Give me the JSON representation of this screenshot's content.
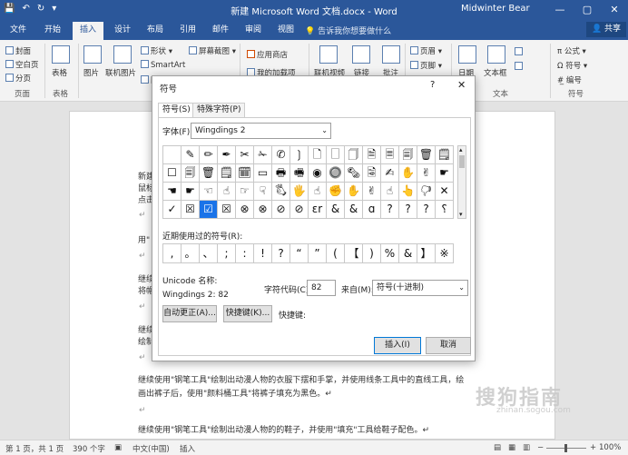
{
  "window": {
    "title": "新建 Microsoft Word 文档.docx  -  Word",
    "user": "Midwinter Bear",
    "min_icon": "—",
    "max_icon": "▢",
    "close_icon": "✕",
    "quick_access": [
      "💾",
      "↶",
      "↻",
      "▾"
    ]
  },
  "tabs": [
    "文件",
    "开始",
    "插入",
    "设计",
    "布局",
    "引用",
    "邮件",
    "审阅",
    "视图"
  ],
  "active_tab": "插入",
  "tell_me": "告诉我你想要做什么",
  "sign_in_icon": "",
  "share_label": "共享",
  "ribbon": {
    "pages": {
      "cover": "封面",
      "blank": "空白页",
      "break": "分页",
      "group": "页面"
    },
    "table": {
      "label": "表格",
      "group": "表格"
    },
    "illustrations": {
      "picture": "图片",
      "online_picture": "联机图片",
      "shapes": "形状",
      "smartart": "SmartArt",
      "chart": "图表",
      "screenshot": "屏幕截图"
    },
    "addins": {
      "store": "应用商店",
      "my_addins": "我的加载项"
    },
    "media": {
      "online_video": "联机视频"
    },
    "links": {
      "link": "链接"
    },
    "comments": {
      "comment": "批注"
    },
    "header_footer": {
      "header": "页眉",
      "footer": "页脚",
      "page_number": "页码"
    },
    "text": {
      "date": "日期",
      "textbox": "文本框",
      "group": "文本"
    },
    "symbols": {
      "equation": "公式",
      "symbol": "符号",
      "numbering": "编号",
      "group": "符号"
    }
  },
  "document": {
    "lines": [
      "新建",
      "鼠标",
      "点击",
      "↵",
      "用\"",
      "↵",
      "继续",
      "将帽",
      "↵",
      "继续",
      "绘制",
      "↵"
    ],
    "para1a": "继续使用\"钢笔工具\"绘制出动漫人物的衣服下摆和手掌，并使用线条工具中的直线工具，绘",
    "para1b": "画出裤子后，使用\"颜料桶工具\"将裤子填充为黑色。↵",
    "para_mark": "↵",
    "para2": "继续使用\"钢笔工具\"绘制出动漫人物的的鞋子，并使用\"填充\"工具给鞋子配色。↵"
  },
  "dialog": {
    "title": "符号",
    "help": "?",
    "close": "✕",
    "tabs": [
      "符号(S)",
      "特殊字符(P)"
    ],
    "font_label": "字体(F):",
    "font_value": "Wingdings 2",
    "symbols": [
      "",
      "✎",
      "✏",
      "✒",
      "✂",
      "✁",
      "✆",
      "❳",
      "🗋",
      "🗌",
      "🗍",
      "🗎",
      "🗏",
      "🗐",
      "🗑",
      "🗒",
      "☐",
      "🗐",
      "🗑",
      "🗒",
      "🗓",
      "▭",
      "🖶",
      "🖷",
      "◉",
      "🔘",
      "🗞",
      "🗟",
      "✍",
      "✋",
      "✌",
      "☛",
      "☚",
      "☛",
      "☜",
      "☝",
      "☞",
      "☟",
      "🖏",
      "🖐",
      "☝",
      "✊",
      "✋",
      "✌",
      "☝",
      "👆",
      "🖓",
      "✕",
      "✓",
      "☒",
      "☑",
      "☒",
      "⊗",
      "⊗",
      "⊘",
      "⊘",
      "ɛr",
      "&",
      "&",
      "ɑ",
      "?",
      "?",
      "?",
      "⸮"
    ],
    "selected_index": 50,
    "recent_label": "近期使用过的符号(R):",
    "recent": [
      ",",
      "。",
      "、",
      ";",
      ":",
      "!",
      "?",
      "“",
      "”",
      "(",
      "【",
      ")",
      "%",
      "&",
      "】",
      "※"
    ],
    "unicode_name_label": "Unicode 名称:",
    "unicode_name_value": "Wingdings 2: 82",
    "charcode_label": "字符代码(C):",
    "charcode_value": "82",
    "from_label": "来自(M):",
    "from_value": "符号(十进制)",
    "autocorrect": "自动更正(A)...",
    "shortcut_key": "快捷键(K)...",
    "shortcut_label": "快捷键:",
    "insert": "插入(I)",
    "cancel": "取消"
  },
  "statusbar": {
    "page": "第 1 页，共 1 页",
    "words": "390 个字",
    "lang_icon": "▣",
    "lang": "中文(中国)",
    "mode": "插入",
    "zoom": "100%",
    "zoom_minus": "−",
    "zoom_plus": "+"
  },
  "watermark": {
    "brand": "搜狗指南",
    "url": "zhinan.sogou.com"
  }
}
